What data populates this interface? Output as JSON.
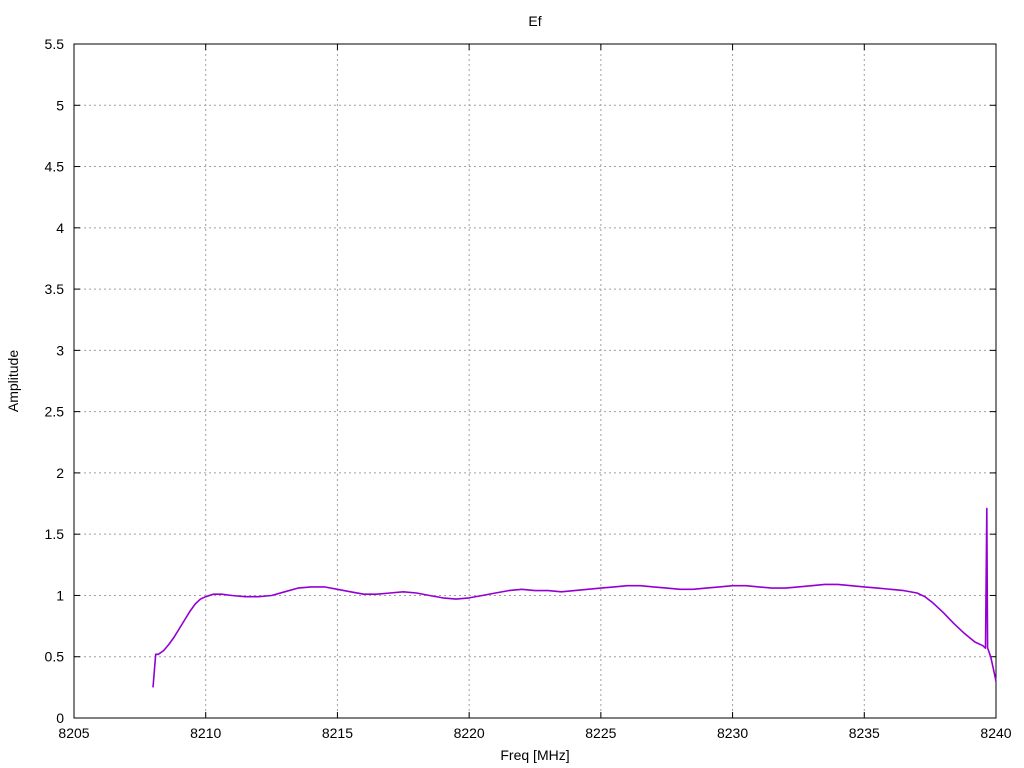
{
  "chart_data": {
    "type": "line",
    "title": "Ef",
    "xlabel": "Freq [MHz]",
    "ylabel": "Amplitude",
    "xlim": [
      8205,
      8240
    ],
    "ylim": [
      0,
      5.5
    ],
    "xticks": [
      8205,
      8210,
      8215,
      8220,
      8225,
      8230,
      8235,
      8240
    ],
    "yticks": [
      0,
      0.5,
      1,
      1.5,
      2,
      2.5,
      3,
      3.5,
      4,
      4.5,
      5,
      5.5
    ],
    "xtick_labels": [
      "8205",
      "8210",
      "8215",
      "8220",
      "8225",
      "8230",
      "8235",
      "8240"
    ],
    "ytick_labels": [
      "0",
      "0.5",
      "1",
      "1.5",
      "2",
      "2.5",
      "3",
      "3.5",
      "4",
      "4.5",
      "5",
      "5.5"
    ],
    "grid": true,
    "series": [
      {
        "color": "#9400d3",
        "x": [
          8208.0,
          8208.05,
          8208.1,
          8208.2,
          8208.4,
          8208.6,
          8208.8,
          8209.0,
          8209.2,
          8209.4,
          8209.6,
          8209.8,
          8210.0,
          8210.3,
          8210.6,
          8211.0,
          8211.5,
          8212.0,
          8212.5,
          8213.0,
          8213.5,
          8214.0,
          8214.5,
          8215.0,
          8215.5,
          8216.0,
          8216.5,
          8217.0,
          8217.5,
          8218.0,
          8218.5,
          8219.0,
          8219.5,
          8220.0,
          8220.5,
          8221.0,
          8221.5,
          8222.0,
          8222.5,
          8223.0,
          8223.5,
          8224.0,
          8224.5,
          8225.0,
          8225.5,
          8226.0,
          8226.5,
          8227.0,
          8227.5,
          8228.0,
          8228.5,
          8229.0,
          8229.5,
          8230.0,
          8230.5,
          8231.0,
          8231.5,
          8232.0,
          8232.5,
          8233.0,
          8233.5,
          8234.0,
          8234.5,
          8235.0,
          8235.5,
          8236.0,
          8236.5,
          8237.0,
          8237.3,
          8237.6,
          8238.0,
          8238.4,
          8238.8,
          8239.2,
          8239.5,
          8239.6,
          8239.65,
          8239.68,
          8239.7,
          8239.8,
          8239.9,
          8240.0
        ],
        "y": [
          0.25,
          0.38,
          0.52,
          0.52,
          0.55,
          0.6,
          0.66,
          0.73,
          0.8,
          0.87,
          0.93,
          0.97,
          0.99,
          1.01,
          1.01,
          1.0,
          0.99,
          0.99,
          1.0,
          1.03,
          1.06,
          1.07,
          1.07,
          1.05,
          1.03,
          1.01,
          1.01,
          1.02,
          1.03,
          1.02,
          1.0,
          0.98,
          0.97,
          0.98,
          1.0,
          1.02,
          1.04,
          1.05,
          1.04,
          1.04,
          1.03,
          1.04,
          1.05,
          1.06,
          1.07,
          1.08,
          1.08,
          1.07,
          1.06,
          1.05,
          1.05,
          1.06,
          1.07,
          1.08,
          1.08,
          1.07,
          1.06,
          1.06,
          1.07,
          1.08,
          1.09,
          1.09,
          1.08,
          1.07,
          1.06,
          1.05,
          1.04,
          1.02,
          0.99,
          0.94,
          0.86,
          0.77,
          0.69,
          0.62,
          0.59,
          0.57,
          1.71,
          0.57,
          0.56,
          0.5,
          0.4,
          0.3
        ]
      }
    ]
  }
}
